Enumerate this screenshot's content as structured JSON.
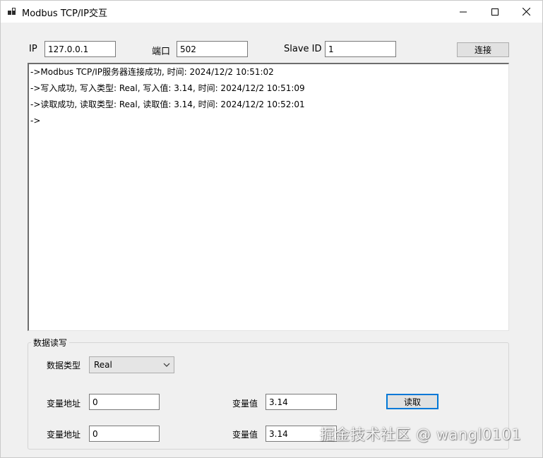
{
  "window": {
    "title": "Modbus TCP/IP交互",
    "icon": "app-window-icon"
  },
  "connection": {
    "ip_label": "IP",
    "ip_value": "127.0.0.1",
    "port_label": "端口",
    "port_value": "502",
    "slave_label": "Slave ID",
    "slave_value": "1",
    "connect_label": "连接"
  },
  "log": {
    "lines": [
      "->Modbus TCP/IP服务器连接成功, 时间: 2024/12/2 10:51:02",
      "->写入成功, 写入类型: Real, 写入值: 3.14, 时间: 2024/12/2 10:51:09",
      "->读取成功, 读取类型: Real, 读取值: 3.14, 时间: 2024/12/2 10:52:01",
      "->"
    ]
  },
  "data_rw": {
    "group_title": "数据读写",
    "type_label": "数据类型",
    "type_value": "Real",
    "row1": {
      "addr_label": "变量地址",
      "addr_value": "0",
      "val_label": "变量值",
      "val_value": "3.14",
      "button_label": "读取"
    },
    "row2": {
      "addr_label": "变量地址",
      "addr_value": "0",
      "val_label": "变量值",
      "val_value": "3.14"
    }
  },
  "watermark": "掘金技术社区 @ wangl0101"
}
